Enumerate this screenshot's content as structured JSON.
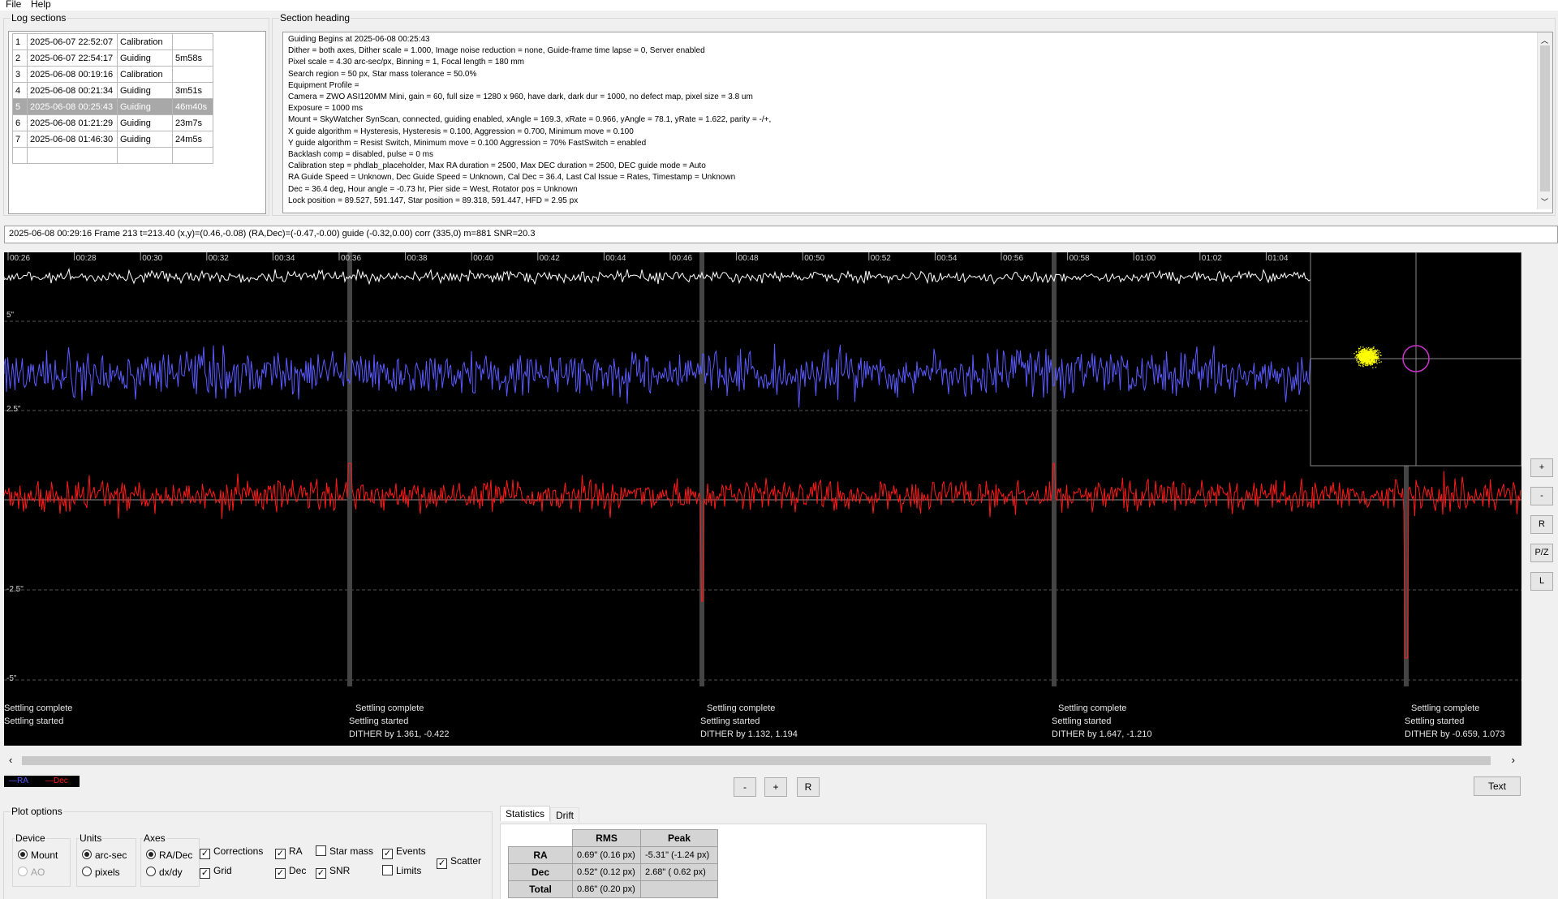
{
  "menu": {
    "file": "File",
    "help": "Help"
  },
  "log_sections": {
    "title": "Log sections",
    "rows": [
      [
        "1",
        "2025-06-07 22:52:07",
        "Calibration",
        ""
      ],
      [
        "2",
        "2025-06-07 22:54:17",
        "Guiding",
        "5m58s"
      ],
      [
        "3",
        "2025-06-08 00:19:16",
        "Calibration",
        ""
      ],
      [
        "4",
        "2025-06-08 00:21:34",
        "Guiding",
        "3m51s"
      ],
      [
        "5",
        "2025-06-08 00:25:43",
        "Guiding",
        "46m40s"
      ],
      [
        "6",
        "2025-06-08 01:21:29",
        "Guiding",
        "23m7s"
      ],
      [
        "7",
        "2025-06-08 01:46:30",
        "Guiding",
        "24m5s"
      ],
      [
        "",
        "",
        "",
        ""
      ]
    ],
    "selected_index": 4
  },
  "section_heading": {
    "title": "Section heading",
    "lines": [
      "Guiding Begins at 2025-06-08 00:25:43",
      "Dither = both axes, Dither scale = 1.000, Image noise reduction = none, Guide-frame time lapse = 0, Server enabled",
      "Pixel scale = 4.30 arc-sec/px, Binning = 1, Focal length = 180 mm",
      "Search region = 50 px, Star mass tolerance = 50.0%",
      "Equipment Profile =",
      "Camera = ZWO ASI120MM Mini, gain = 60, full size = 1280 x 960, have dark, dark dur = 1000, no defect map, pixel size = 3.8 um",
      "Exposure = 1000 ms",
      "Mount = SkyWatcher SynScan,  connected, guiding enabled, xAngle = 169.3, xRate = 0.966, yAngle = 78.1, yRate = 1.622, parity = -/+,",
      "X guide algorithm = Hysteresis, Hysteresis = 0.100, Aggression = 0.700, Minimum move = 0.100",
      "Y guide algorithm = Resist Switch, Minimum move = 0.100 Aggression = 70% FastSwitch = enabled",
      "Backlash comp = disabled, pulse = 0 ms",
      "Calibration step = phdlab_placeholder, Max RA duration = 2500, Max DEC duration = 2500, DEC guide mode = Auto",
      "RA Guide Speed = Unknown, Dec Guide Speed = Unknown, Cal Dec = 36.4, Last Cal Issue = Rates, Timestamp = Unknown",
      "Dec = 36.4 deg, Hour angle = -0.73 hr, Pier side = West, Rotator pos = Unknown",
      "Lock position = 89.527, 591.147, Star position = 89.318, 591.447, HFD = 2.95 px"
    ]
  },
  "status_line": "2025-06-08 00:29:16 Frame 213 t=213.40 (x,y)=(0.46,-0.08) (RA,Dec)=(-0.47,-0.00) guide (-0.32,0.00) corr (335,0) m=881 SNR=20.3",
  "graph": {
    "time_ticks": [
      "00:26",
      "00:28",
      "00:30",
      "00:32",
      "00:34",
      "00:36",
      "00:38",
      "00:40",
      "00:42",
      "00:44",
      "00:46",
      "00:48",
      "00:50",
      "00:52",
      "00:54",
      "00:56",
      "00:58",
      "01:00",
      "01:02",
      "01:04"
    ],
    "y_labels": [
      "5\"",
      "2.5\"",
      "-2.5\"",
      "-5\""
    ],
    "events": [
      {
        "settle_complete": "Settling complete",
        "settle_started": "Settling started",
        "dither": ""
      },
      {
        "settle_complete": "Settling complete",
        "settle_started": "Settling started",
        "dither": "DITHER by 1.361, -0.422"
      },
      {
        "settle_complete": "Settling complete",
        "settle_started": "Settling started",
        "dither": "DITHER by 1.132, 1.194"
      },
      {
        "settle_complete": "Settling complete",
        "settle_started": "Settling started",
        "dither": "DITHER by 1.647, -1.210"
      },
      {
        "settle_complete": "Settling complete",
        "settle_started": "Settling started",
        "dither": "DITHER by -0.659, 1.073"
      }
    ],
    "colors": {
      "ra": "#5a5aff",
      "dec": "#ff1a1a",
      "snr": "#ffffff",
      "scatter": "#ffff00",
      "target": "#cc33cc"
    }
  },
  "legend": {
    "ra": "RA",
    "dec": "Dec"
  },
  "side_buttons": [
    "+",
    "-",
    "R",
    "P/Z",
    "L"
  ],
  "zoom_buttons": [
    "-",
    "+",
    "R"
  ],
  "text_button": "Text",
  "plot_options": {
    "title": "Plot options",
    "device": {
      "title": "Device",
      "mount": "Mount",
      "ao": "AO"
    },
    "units": {
      "title": "Units",
      "arcsec": "arc-sec",
      "pixels": "pixels"
    },
    "axes": {
      "title": "Axes",
      "radec": "RA/Dec",
      "dxdy": "dx/dy"
    },
    "checks": {
      "corrections": "Corrections",
      "grid": "Grid",
      "ra": "RA",
      "dec": "Dec",
      "star_mass": "Star mass",
      "snr": "SNR",
      "events": "Events",
      "limits": "Limits",
      "scatter": "Scatter"
    }
  },
  "stats": {
    "tab_statistics": "Statistics",
    "tab_drift": "Drift",
    "col_rms": "RMS",
    "col_peak": "Peak",
    "rows": [
      {
        "label": "RA",
        "rms": "0.69\" (0.16 px)",
        "peak": "-5.31\" (-1.24 px)"
      },
      {
        "label": "Dec",
        "rms": "0.52\" (0.12 px)",
        "peak": "2.68\" ( 0.62 px)"
      },
      {
        "label": "Total",
        "rms": "0.86\" (0.20 px)",
        "peak": ""
      }
    ]
  }
}
